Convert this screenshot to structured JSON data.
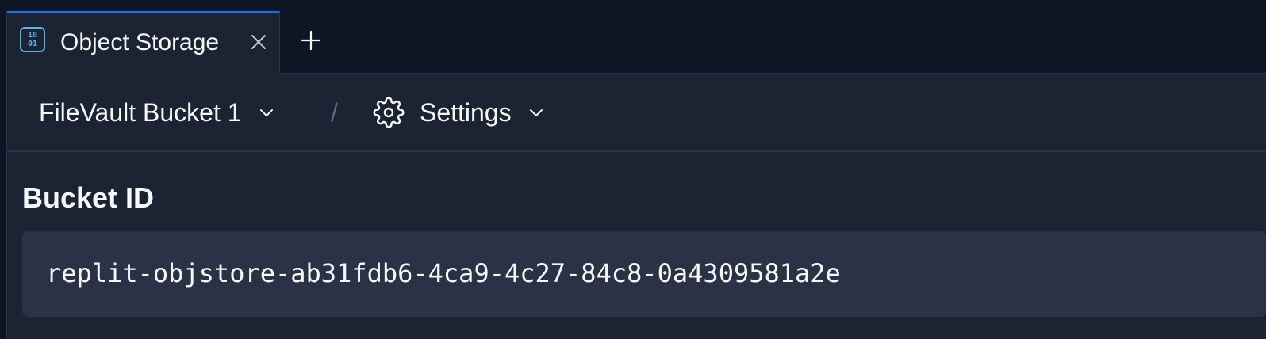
{
  "tabs": [
    {
      "label": "Object Storage",
      "icon": "binary-icon",
      "icon_glyph_top": "10",
      "icon_glyph_bottom": "01",
      "active": true
    }
  ],
  "breadcrumb": {
    "bucket": "FileVault Bucket 1",
    "separator": "/",
    "section": "Settings"
  },
  "main": {
    "section_title": "Bucket ID",
    "bucket_id": "replit-objstore-ab31fdb6-4ca9-4c27-84c8-0a4309581a2e"
  },
  "colors": {
    "background": "#0e1525",
    "panel": "#1c2333",
    "field": "#2b3245",
    "accent": "#0079f2",
    "icon": "#56b5e6"
  }
}
